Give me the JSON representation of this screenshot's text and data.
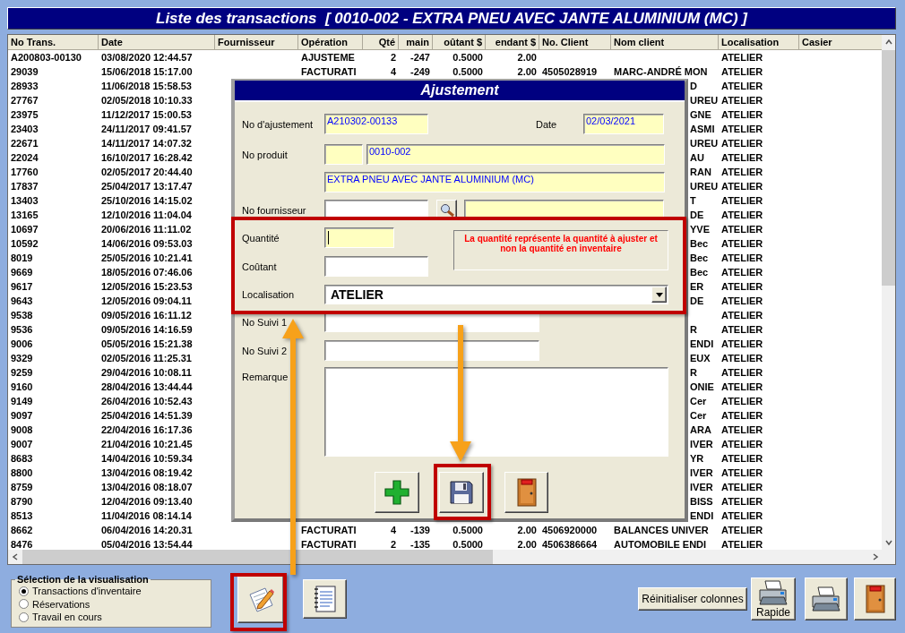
{
  "window": {
    "title": "Liste des transactions  [ 0010-002 - EXTRA PNEU AVEC JANTE ALUMINIUM (MC) ]"
  },
  "table": {
    "columns": [
      "No Trans.",
      "Date",
      "Fournisseur",
      "Opération",
      "Qté",
      "main",
      "oûtant $",
      "endant $",
      "No. Client",
      "Nom client",
      "Localisation",
      "Casier"
    ],
    "rows": [
      {
        "kind": "full",
        "no_trans": "A200803-00130",
        "date": "03/08/2020 12:44.57",
        "operation": "AJUSTEME",
        "qty": "2",
        "on_hand": "-247",
        "cost": "0.5000",
        "price": "2.00",
        "localisation": "ATELIER"
      },
      {
        "kind": "full",
        "no_trans": "29039",
        "date": "15/06/2018 15:17.00",
        "operation": "FACTURATI",
        "qty": "4",
        "on_hand": "-249",
        "cost": "0.5000",
        "price": "2.00",
        "client_no": "4505028919",
        "client_name": "MARC-ANDRÉ MON",
        "localisation": "ATELIER"
      },
      {
        "kind": "partial",
        "no_trans": "28933",
        "date": "11/06/2018 15:58.53",
        "client_name": "D",
        "localisation": "ATELIER"
      },
      {
        "kind": "partial",
        "no_trans": "27767",
        "date": "02/05/2018 10:10.33",
        "client_name": "UREU",
        "localisation": "ATELIER"
      },
      {
        "kind": "partial",
        "no_trans": "23975",
        "date": "11/12/2017 15:00.53",
        "client_name": "GNE",
        "localisation": "ATELIER"
      },
      {
        "kind": "partial",
        "no_trans": "23403",
        "date": "24/11/2017 09:41.57",
        "client_name": "ASMI",
        "localisation": "ATELIER"
      },
      {
        "kind": "partial",
        "no_trans": "22671",
        "date": "14/11/2017 14:07.32",
        "client_name": "UREU",
        "localisation": "ATELIER"
      },
      {
        "kind": "partial",
        "no_trans": "22024",
        "date": "16/10/2017 16:28.42",
        "client_name": "AU",
        "localisation": "ATELIER"
      },
      {
        "kind": "partial",
        "no_trans": "17760",
        "date": "02/05/2017 20:44.40",
        "client_name": "RAN",
        "localisation": "ATELIER"
      },
      {
        "kind": "partial",
        "no_trans": "17837",
        "date": "25/04/2017 13:17.47",
        "client_name": "UREU",
        "localisation": "ATELIER"
      },
      {
        "kind": "partial",
        "no_trans": "13403",
        "date": "25/10/2016 14:15.02",
        "client_name": "T",
        "localisation": "ATELIER"
      },
      {
        "kind": "partial",
        "no_trans": "13165",
        "date": "12/10/2016 11:04.04",
        "client_name": "DE",
        "localisation": "ATELIER"
      },
      {
        "kind": "partial",
        "no_trans": "10697",
        "date": "20/06/2016 11:11.02",
        "client_name": "YVE",
        "localisation": "ATELIER"
      },
      {
        "kind": "partial",
        "no_trans": "10592",
        "date": "14/06/2016 09:53.03",
        "client_name": "Bec",
        "localisation": "ATELIER"
      },
      {
        "kind": "partial",
        "no_trans": "8019",
        "date": "25/05/2016 10:21.41",
        "client_name": "Bec",
        "localisation": "ATELIER"
      },
      {
        "kind": "partial",
        "no_trans": "9669",
        "date": "18/05/2016 07:46.06",
        "client_name": "Bec",
        "localisation": "ATELIER"
      },
      {
        "kind": "partial",
        "no_trans": "9617",
        "date": "12/05/2016 15:23.53",
        "client_name": "ER",
        "localisation": "ATELIER"
      },
      {
        "kind": "partial",
        "no_trans": "9643",
        "date": "12/05/2016 09:04.11",
        "client_name": "DE",
        "localisation": "ATELIER"
      },
      {
        "kind": "partial",
        "no_trans": "9538",
        "date": "09/05/2016 16:11.12",
        "localisation": "ATELIER"
      },
      {
        "kind": "partial",
        "no_trans": "9536",
        "date": "09/05/2016 14:16.59",
        "client_name": "R",
        "localisation": "ATELIER"
      },
      {
        "kind": "partial",
        "no_trans": "9006",
        "date": "05/05/2016 15:21.38",
        "client_name": "ENDI",
        "localisation": "ATELIER"
      },
      {
        "kind": "partial",
        "no_trans": "9329",
        "date": "02/05/2016 11:25.31",
        "client_name": "EUX",
        "localisation": "ATELIER"
      },
      {
        "kind": "partial",
        "no_trans": "9259",
        "date": "29/04/2016 10:08.11",
        "client_name": "R",
        "localisation": "ATELIER"
      },
      {
        "kind": "partial",
        "no_trans": "9160",
        "date": "28/04/2016 13:44.44",
        "client_name": "ONIE",
        "localisation": "ATELIER"
      },
      {
        "kind": "partial",
        "no_trans": "9149",
        "date": "26/04/2016 10:52.43",
        "client_name": "Cer",
        "localisation": "ATELIER"
      },
      {
        "kind": "partial",
        "no_trans": "9097",
        "date": "25/04/2016 14:51.39",
        "client_name": "Cer",
        "localisation": "ATELIER"
      },
      {
        "kind": "partial",
        "no_trans": "9008",
        "date": "22/04/2016 16:17.36",
        "client_name": "ARA",
        "localisation": "ATELIER"
      },
      {
        "kind": "partial",
        "no_trans": "9007",
        "date": "21/04/2016 10:21.45",
        "client_name": "IVER",
        "localisation": "ATELIER"
      },
      {
        "kind": "partial",
        "no_trans": "8683",
        "date": "14/04/2016 10:59.34",
        "client_name": "YR",
        "localisation": "ATELIER"
      },
      {
        "kind": "partial",
        "no_trans": "8800",
        "date": "13/04/2016 08:19.42",
        "client_name": "IVER",
        "localisation": "ATELIER"
      },
      {
        "kind": "partial",
        "no_trans": "8759",
        "date": "13/04/2016 08:18.07",
        "client_name": "IVER",
        "localisation": "ATELIER"
      },
      {
        "kind": "partial",
        "no_trans": "8790",
        "date": "12/04/2016 09:13.40",
        "client_name": "BISS",
        "localisation": "ATELIER"
      },
      {
        "kind": "partial",
        "no_trans": "8513",
        "date": "11/04/2016 08:14.14",
        "client_name": "ENDI",
        "localisation": "ATELIER"
      },
      {
        "kind": "full",
        "no_trans": "8662",
        "date": "06/04/2016 14:20.31",
        "operation": "FACTURATI",
        "qty": "4",
        "on_hand": "-139",
        "cost": "0.5000",
        "price": "2.00",
        "client_no": "4506920000",
        "client_name": "BALANCES UNIVER",
        "localisation": "ATELIER"
      },
      {
        "kind": "full",
        "no_trans": "8476",
        "date": "05/04/2016 13:54.44",
        "operation": "FACTURATI",
        "qty": "2",
        "on_hand": "-135",
        "cost": "0.5000",
        "price": "2.00",
        "client_no": "4506386664",
        "client_name": "AUTOMOBILE ENDI",
        "localisation": "ATELIER"
      }
    ]
  },
  "dialog": {
    "title": "Ajustement",
    "adjustment_no": {
      "label": "No d'ajustement",
      "value": "A210302-00133"
    },
    "date": {
      "label": "Date",
      "value": "02/03/2021"
    },
    "product": {
      "label": "No produit",
      "code": "0010-002",
      "description": "EXTRA PNEU AVEC JANTE ALUMINIUM (MC)"
    },
    "supplier": {
      "label": "No fournisseur"
    },
    "quantity": {
      "label": "Quantité",
      "focused": true
    },
    "note": "La quantité représente la quantité à ajuster et non la quantité en inventaire",
    "cost": {
      "label": "Coûtant"
    },
    "location": {
      "label": "Localisation",
      "value": "ATELIER"
    },
    "tracking_1": {
      "label": "No Suivi 1"
    },
    "tracking_2": {
      "label": "No Suivi 2"
    },
    "remark": {
      "label": "Remarque"
    }
  },
  "view_selection": {
    "title": "Sélection de la visualisation",
    "options": [
      {
        "label": "Transactions d'inventaire",
        "selected": true
      },
      {
        "label": "Réservations",
        "selected": false
      },
      {
        "label": "Travail en cours",
        "selected": false
      }
    ]
  },
  "toolbar": {
    "reset_columns": "Réinitialiser colonnes",
    "quick_print": "Rapide"
  }
}
